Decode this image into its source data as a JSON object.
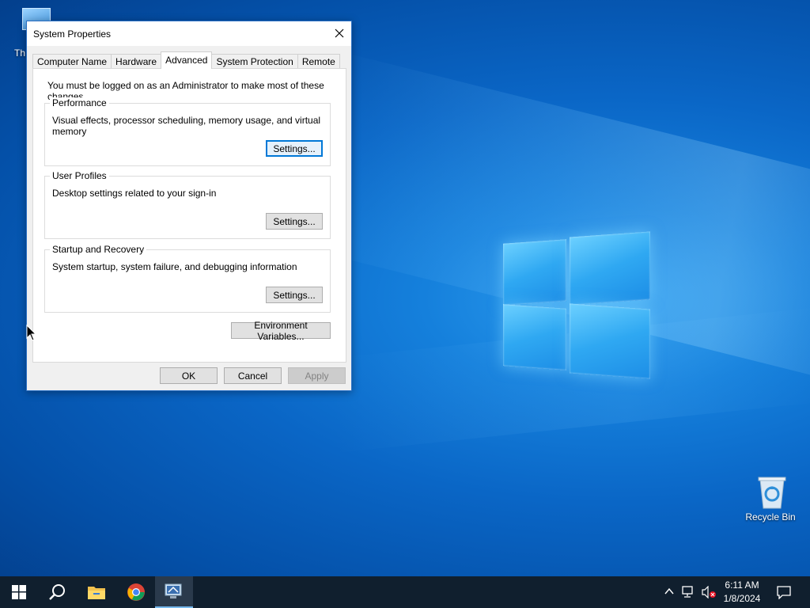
{
  "desktop": {
    "icons": {
      "this_pc_label": "Th",
      "recycle_bin_label": "Recycle Bin"
    }
  },
  "dialog": {
    "title": "System Properties",
    "tabs": [
      {
        "label": "Computer Name"
      },
      {
        "label": "Hardware"
      },
      {
        "label": "Advanced"
      },
      {
        "label": "System Protection"
      },
      {
        "label": "Remote"
      }
    ],
    "active_tab": "Advanced",
    "admin_note": "You must be logged on as an Administrator to make most of these changes.",
    "groups": {
      "performance": {
        "legend": "Performance",
        "description": "Visual effects, processor scheduling, memory usage, and virtual memory",
        "button": "Settings..."
      },
      "user_profiles": {
        "legend": "User Profiles",
        "description": "Desktop settings related to your sign-in",
        "button": "Settings..."
      },
      "startup_recovery": {
        "legend": "Startup and Recovery",
        "description": "System startup, system failure, and debugging information",
        "button": "Settings..."
      }
    },
    "env_button": "Environment Variables...",
    "footer": {
      "ok": "OK",
      "cancel": "Cancel",
      "apply": "Apply"
    }
  },
  "taskbar": {
    "items": [
      "start-icon",
      "search-icon",
      "file-explorer-icon",
      "chrome-icon",
      "system-properties-icon"
    ],
    "clock": {
      "time": "6:11 AM",
      "date": "1/8/2024"
    }
  },
  "colors": {
    "accent": "#0078d7",
    "taskbar": "#101f2e",
    "desktop": "#0a66c6"
  }
}
